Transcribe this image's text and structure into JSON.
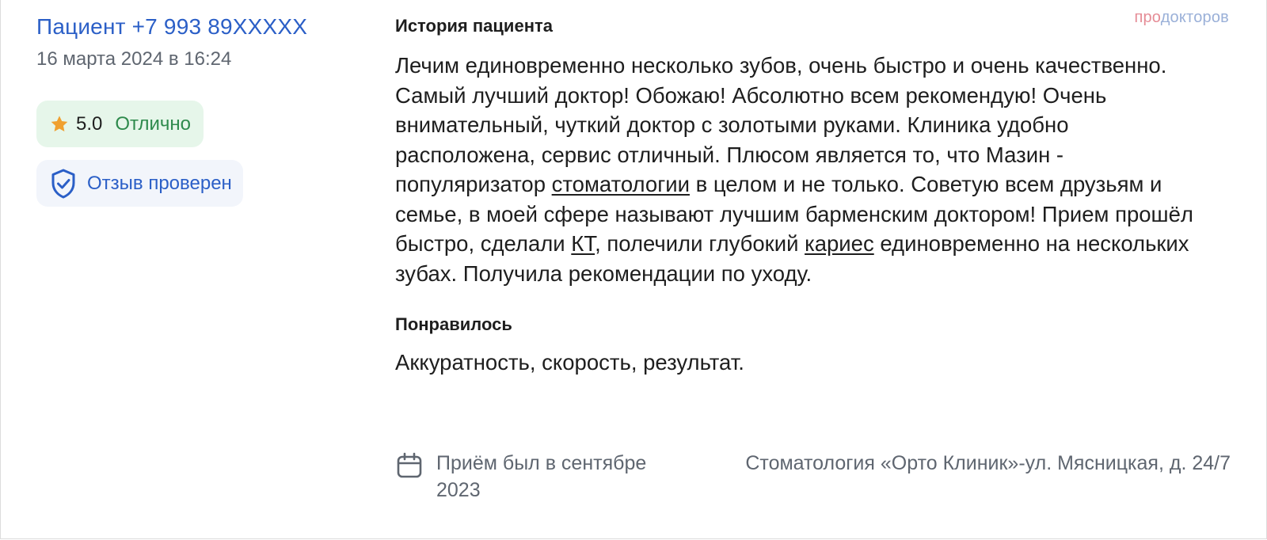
{
  "author": {
    "name": "Пациент +7 993 89XXXXX",
    "date": "16 марта 2024 в 16:24"
  },
  "rating": {
    "score": "5.0",
    "label": "Отлично",
    "icon": "star-icon",
    "color": "#f0a030"
  },
  "verified": {
    "label": "Отзыв проверен",
    "icon": "shield-check-icon"
  },
  "logo": {
    "part1": "про",
    "part2": "докторов"
  },
  "story": {
    "title": "История пациента",
    "text1": "Лечим единовременно несколько зубов, очень быстро и очень качественно. Самый лучший доктор! Обожаю! Абсолютно всем рекомендую! Очень внимательный, чуткий доктор с золотыми руками. Клиника удобно расположена, сервис отличный. Плюсом является то, что Мазин - популяризатор ",
    "link1": "стоматологии",
    "text2": " в целом и не только. Советую всем друзьям и семье, в моей сфере называют лучшим барменским доктором! Прием прошёл быстро, сделали ",
    "link2": "КТ",
    "text3": ", полечили глубокий ",
    "link3": "кариес",
    "text4": " единовременно на нескольких зубах. Получила рекомендации по уходу."
  },
  "liked": {
    "title": "Понравилось",
    "text": "Аккуратность, скорость, результат."
  },
  "meta": {
    "visit": "Приём был в сентябре 2023",
    "visit_icon": "calendar-icon",
    "clinic": "Стоматология «Орто Клиник»-ул. Мясницкая, д. 24/7"
  }
}
